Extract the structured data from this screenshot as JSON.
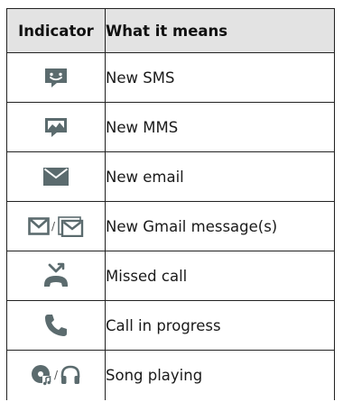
{
  "table": {
    "headers": {
      "indicator": "Indicator",
      "meaning": "What it means"
    },
    "separator": "/",
    "rows": [
      {
        "icon": "sms-icon",
        "meaning": "New SMS"
      },
      {
        "icon": "mms-icon",
        "meaning": "New MMS"
      },
      {
        "icon": "email-icon",
        "meaning": "New email"
      },
      {
        "icon": "gmail-icon",
        "meaning": "New Gmail message(s)"
      },
      {
        "icon": "missed-call-icon",
        "meaning": "Missed call"
      },
      {
        "icon": "call-in-progress-icon",
        "meaning": "Call in progress"
      },
      {
        "icon": "song-playing-icon",
        "meaning": "Song playing"
      }
    ]
  },
  "colors": {
    "icon": "#5b6b6e",
    "header_bg": "#e3e3e3",
    "border": "#222222"
  }
}
